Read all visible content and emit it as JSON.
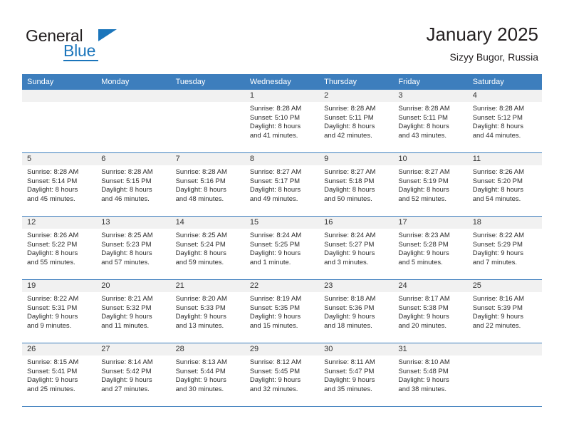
{
  "brand": {
    "name_top": "General",
    "name_bottom": "Blue",
    "accent_color": "#1b75bb",
    "logo_icon": "triangle-flag-icon"
  },
  "header": {
    "title": "January 2025",
    "subtitle": "Sizyy Bugor, Russia"
  },
  "colors": {
    "header_row_blue": "#3d7ebd",
    "day_header_gray": "#f1f1f1",
    "text": "#231f20"
  },
  "calendar": {
    "day_names": [
      "Sunday",
      "Monday",
      "Tuesday",
      "Wednesday",
      "Thursday",
      "Friday",
      "Saturday"
    ],
    "weeks": [
      [
        {
          "day": "",
          "sunrise": "",
          "sunset": "",
          "daylight1": "",
          "daylight2": ""
        },
        {
          "day": "",
          "sunrise": "",
          "sunset": "",
          "daylight1": "",
          "daylight2": ""
        },
        {
          "day": "",
          "sunrise": "",
          "sunset": "",
          "daylight1": "",
          "daylight2": ""
        },
        {
          "day": "1",
          "sunrise": "Sunrise: 8:28 AM",
          "sunset": "Sunset: 5:10 PM",
          "daylight1": "Daylight: 8 hours",
          "daylight2": "and 41 minutes."
        },
        {
          "day": "2",
          "sunrise": "Sunrise: 8:28 AM",
          "sunset": "Sunset: 5:11 PM",
          "daylight1": "Daylight: 8 hours",
          "daylight2": "and 42 minutes."
        },
        {
          "day": "3",
          "sunrise": "Sunrise: 8:28 AM",
          "sunset": "Sunset: 5:11 PM",
          "daylight1": "Daylight: 8 hours",
          "daylight2": "and 43 minutes."
        },
        {
          "day": "4",
          "sunrise": "Sunrise: 8:28 AM",
          "sunset": "Sunset: 5:12 PM",
          "daylight1": "Daylight: 8 hours",
          "daylight2": "and 44 minutes."
        }
      ],
      [
        {
          "day": "5",
          "sunrise": "Sunrise: 8:28 AM",
          "sunset": "Sunset: 5:14 PM",
          "daylight1": "Daylight: 8 hours",
          "daylight2": "and 45 minutes."
        },
        {
          "day": "6",
          "sunrise": "Sunrise: 8:28 AM",
          "sunset": "Sunset: 5:15 PM",
          "daylight1": "Daylight: 8 hours",
          "daylight2": "and 46 minutes."
        },
        {
          "day": "7",
          "sunrise": "Sunrise: 8:28 AM",
          "sunset": "Sunset: 5:16 PM",
          "daylight1": "Daylight: 8 hours",
          "daylight2": "and 48 minutes."
        },
        {
          "day": "8",
          "sunrise": "Sunrise: 8:27 AM",
          "sunset": "Sunset: 5:17 PM",
          "daylight1": "Daylight: 8 hours",
          "daylight2": "and 49 minutes."
        },
        {
          "day": "9",
          "sunrise": "Sunrise: 8:27 AM",
          "sunset": "Sunset: 5:18 PM",
          "daylight1": "Daylight: 8 hours",
          "daylight2": "and 50 minutes."
        },
        {
          "day": "10",
          "sunrise": "Sunrise: 8:27 AM",
          "sunset": "Sunset: 5:19 PM",
          "daylight1": "Daylight: 8 hours",
          "daylight2": "and 52 minutes."
        },
        {
          "day": "11",
          "sunrise": "Sunrise: 8:26 AM",
          "sunset": "Sunset: 5:20 PM",
          "daylight1": "Daylight: 8 hours",
          "daylight2": "and 54 minutes."
        }
      ],
      [
        {
          "day": "12",
          "sunrise": "Sunrise: 8:26 AM",
          "sunset": "Sunset: 5:22 PM",
          "daylight1": "Daylight: 8 hours",
          "daylight2": "and 55 minutes."
        },
        {
          "day": "13",
          "sunrise": "Sunrise: 8:25 AM",
          "sunset": "Sunset: 5:23 PM",
          "daylight1": "Daylight: 8 hours",
          "daylight2": "and 57 minutes."
        },
        {
          "day": "14",
          "sunrise": "Sunrise: 8:25 AM",
          "sunset": "Sunset: 5:24 PM",
          "daylight1": "Daylight: 8 hours",
          "daylight2": "and 59 minutes."
        },
        {
          "day": "15",
          "sunrise": "Sunrise: 8:24 AM",
          "sunset": "Sunset: 5:25 PM",
          "daylight1": "Daylight: 9 hours",
          "daylight2": "and 1 minute."
        },
        {
          "day": "16",
          "sunrise": "Sunrise: 8:24 AM",
          "sunset": "Sunset: 5:27 PM",
          "daylight1": "Daylight: 9 hours",
          "daylight2": "and 3 minutes."
        },
        {
          "day": "17",
          "sunrise": "Sunrise: 8:23 AM",
          "sunset": "Sunset: 5:28 PM",
          "daylight1": "Daylight: 9 hours",
          "daylight2": "and 5 minutes."
        },
        {
          "day": "18",
          "sunrise": "Sunrise: 8:22 AM",
          "sunset": "Sunset: 5:29 PM",
          "daylight1": "Daylight: 9 hours",
          "daylight2": "and 7 minutes."
        }
      ],
      [
        {
          "day": "19",
          "sunrise": "Sunrise: 8:22 AM",
          "sunset": "Sunset: 5:31 PM",
          "daylight1": "Daylight: 9 hours",
          "daylight2": "and 9 minutes."
        },
        {
          "day": "20",
          "sunrise": "Sunrise: 8:21 AM",
          "sunset": "Sunset: 5:32 PM",
          "daylight1": "Daylight: 9 hours",
          "daylight2": "and 11 minutes."
        },
        {
          "day": "21",
          "sunrise": "Sunrise: 8:20 AM",
          "sunset": "Sunset: 5:33 PM",
          "daylight1": "Daylight: 9 hours",
          "daylight2": "and 13 minutes."
        },
        {
          "day": "22",
          "sunrise": "Sunrise: 8:19 AM",
          "sunset": "Sunset: 5:35 PM",
          "daylight1": "Daylight: 9 hours",
          "daylight2": "and 15 minutes."
        },
        {
          "day": "23",
          "sunrise": "Sunrise: 8:18 AM",
          "sunset": "Sunset: 5:36 PM",
          "daylight1": "Daylight: 9 hours",
          "daylight2": "and 18 minutes."
        },
        {
          "day": "24",
          "sunrise": "Sunrise: 8:17 AM",
          "sunset": "Sunset: 5:38 PM",
          "daylight1": "Daylight: 9 hours",
          "daylight2": "and 20 minutes."
        },
        {
          "day": "25",
          "sunrise": "Sunrise: 8:16 AM",
          "sunset": "Sunset: 5:39 PM",
          "daylight1": "Daylight: 9 hours",
          "daylight2": "and 22 minutes."
        }
      ],
      [
        {
          "day": "26",
          "sunrise": "Sunrise: 8:15 AM",
          "sunset": "Sunset: 5:41 PM",
          "daylight1": "Daylight: 9 hours",
          "daylight2": "and 25 minutes."
        },
        {
          "day": "27",
          "sunrise": "Sunrise: 8:14 AM",
          "sunset": "Sunset: 5:42 PM",
          "daylight1": "Daylight: 9 hours",
          "daylight2": "and 27 minutes."
        },
        {
          "day": "28",
          "sunrise": "Sunrise: 8:13 AM",
          "sunset": "Sunset: 5:44 PM",
          "daylight1": "Daylight: 9 hours",
          "daylight2": "and 30 minutes."
        },
        {
          "day": "29",
          "sunrise": "Sunrise: 8:12 AM",
          "sunset": "Sunset: 5:45 PM",
          "daylight1": "Daylight: 9 hours",
          "daylight2": "and 32 minutes."
        },
        {
          "day": "30",
          "sunrise": "Sunrise: 8:11 AM",
          "sunset": "Sunset: 5:47 PM",
          "daylight1": "Daylight: 9 hours",
          "daylight2": "and 35 minutes."
        },
        {
          "day": "31",
          "sunrise": "Sunrise: 8:10 AM",
          "sunset": "Sunset: 5:48 PM",
          "daylight1": "Daylight: 9 hours",
          "daylight2": "and 38 minutes."
        },
        {
          "day": "",
          "sunrise": "",
          "sunset": "",
          "daylight1": "",
          "daylight2": ""
        }
      ]
    ]
  }
}
